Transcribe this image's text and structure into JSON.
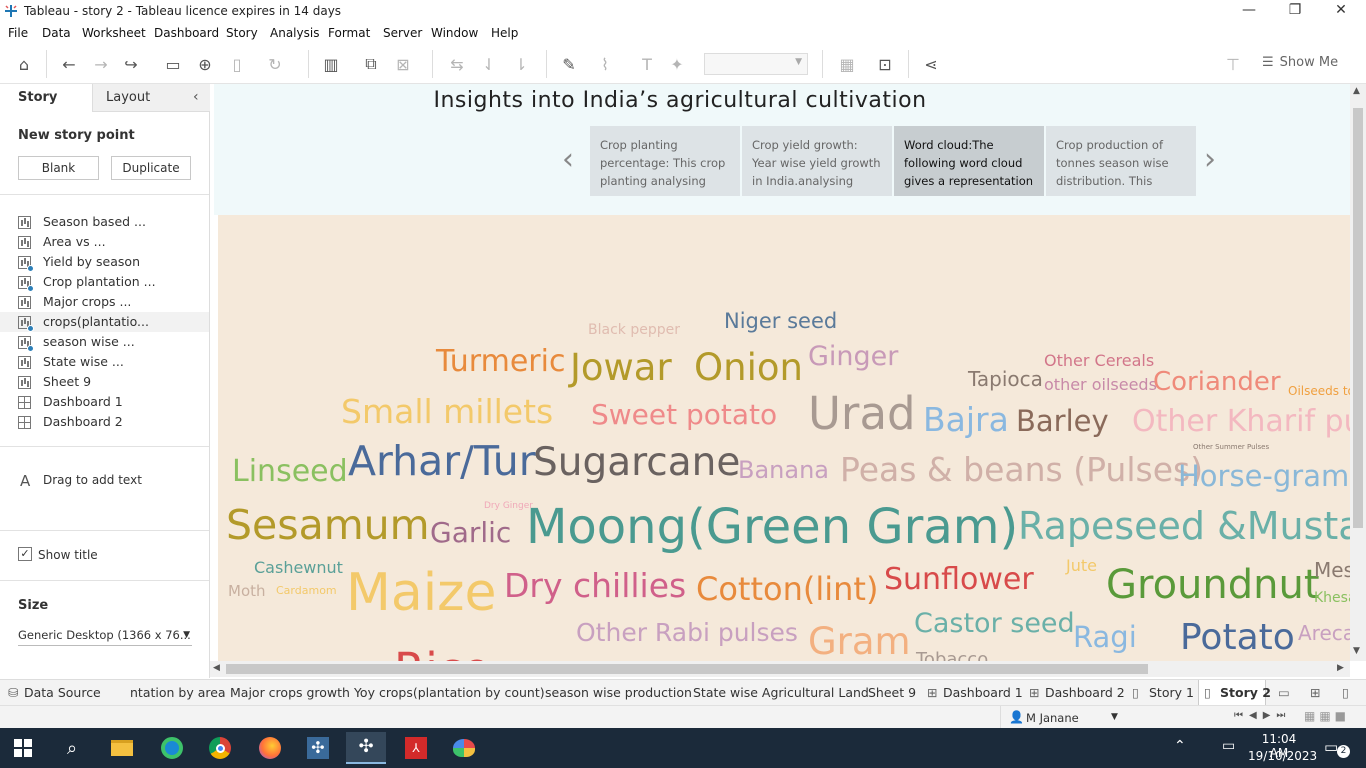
{
  "window": {
    "title": "Tableau - story 2 - Tableau licence expires in 14 days"
  },
  "menu": [
    "File",
    "Data",
    "Worksheet",
    "Dashboard",
    "Story",
    "Analysis",
    "Format",
    "Server",
    "Window",
    "Help"
  ],
  "toolbar": {
    "show_me": "Show Me"
  },
  "left_pane": {
    "tabs": [
      "Story",
      "Layout"
    ],
    "new_story_point": "New story point",
    "blank_button": "Blank",
    "duplicate_button": "Duplicate",
    "sheets": [
      {
        "label": "Season based ...",
        "type": "chart",
        "used": false
      },
      {
        "label": "Area vs ...",
        "type": "chart",
        "used": false
      },
      {
        "label": "Yield by season",
        "type": "chart",
        "used": true
      },
      {
        "label": "Crop plantation ...",
        "type": "chart",
        "used": true
      },
      {
        "label": "Major crops ...",
        "type": "chart",
        "used": false
      },
      {
        "label": "crops(plantatio...",
        "type": "chart",
        "used": true
      },
      {
        "label": "season wise ...",
        "type": "chart",
        "used": true
      },
      {
        "label": "State wise ...",
        "type": "chart",
        "used": false
      },
      {
        "label": "Sheet 9",
        "type": "chart",
        "used": false
      },
      {
        "label": "Dashboard 1",
        "type": "dash",
        "used": false
      },
      {
        "label": "Dashboard 2",
        "type": "dash",
        "used": false
      }
    ],
    "drag_text": "Drag to add text",
    "show_title": "Show title",
    "size_label": "Size",
    "size_value": "Generic Desktop (1366 x 76..."
  },
  "story": {
    "title": "Insights into India’s agricultural cultivation",
    "points": [
      "Crop planting percentage: This crop planting analysing",
      "Crop yield growth: Year wise yield growth in India.analysing",
      "Word cloud:The following word cloud gives a representation",
      "Crop production of tonnes season wise distribution. This"
    ]
  },
  "word_cloud": [
    {
      "t": "Black pepper",
      "c": "#e0bcb0"
    },
    {
      "t": "Niger seed",
      "c": "#5a7a9a"
    },
    {
      "t": "Turmeric",
      "c": "#e88a3c"
    },
    {
      "t": "Jowar",
      "c": "#b39a2a"
    },
    {
      "t": "Onion",
      "c": "#b39a2a"
    },
    {
      "t": "Ginger",
      "c": "#c89ab8"
    },
    {
      "t": "Other Cereals",
      "c": "#d2768a"
    },
    {
      "t": "Tapioca",
      "c": "#8a7a70"
    },
    {
      "t": "other oilseeds",
      "c": "#c88aa8"
    },
    {
      "t": "Coriander",
      "c": "#ef8a7a"
    },
    {
      "t": "Oilseeds total",
      "c": "#f0a040"
    },
    {
      "t": "Small millets",
      "c": "#f3c96a"
    },
    {
      "t": "Sweet potato",
      "c": "#ef8a8a"
    },
    {
      "t": "Urad",
      "c": "#a89a92"
    },
    {
      "t": "Bajra",
      "c": "#8ab8e0"
    },
    {
      "t": "Barley",
      "c": "#8a6a5a"
    },
    {
      "t": "Other Kharif pulses",
      "c": "#f3b8c0"
    },
    {
      "t": "Other Summer Pulses",
      "c": "#8a7a70"
    },
    {
      "t": "Linseed",
      "c": "#8ac060"
    },
    {
      "t": "Arhar/Tur",
      "c": "#4a6a9a"
    },
    {
      "t": "Sugarcane",
      "c": "#6a6260"
    },
    {
      "t": "Banana",
      "c": "#c8a0c0"
    },
    {
      "t": "Peas & beans (Pulses)",
      "c": "#d0b0a8"
    },
    {
      "t": "Horse-gram",
      "c": "#8ab8d8"
    },
    {
      "t": "Dry Ginger",
      "c": "#f0a8b8"
    },
    {
      "t": "Sesamum",
      "c": "#b39a2a"
    },
    {
      "t": "Garlic",
      "c": "#a06a8a"
    },
    {
      "t": "Moong(Green Gram)",
      "c": "#4a9a90"
    },
    {
      "t": "Rapeseed &Mustard",
      "c": "#6ab0a8"
    },
    {
      "t": "Cashewnut",
      "c": "#5aa098"
    },
    {
      "t": "Jute",
      "c": "#f3c96a"
    },
    {
      "t": "Moth",
      "c": "#c8b0a0"
    },
    {
      "t": "Cardamom",
      "c": "#f3c96a"
    },
    {
      "t": "Maize",
      "c": "#f3c96a"
    },
    {
      "t": "Dry chillies",
      "c": "#d0608a"
    },
    {
      "t": "Cotton(lint)",
      "c": "#e88a3c"
    },
    {
      "t": "Sunflower",
      "c": "#d84a4a"
    },
    {
      "t": "Groundnut",
      "c": "#5a9a3a"
    },
    {
      "t": "Mesta",
      "c": "#8a7a70"
    },
    {
      "t": "Khesari",
      "c": "#8ac060"
    },
    {
      "t": "Other Rabi pulses",
      "c": "#c8a0c0"
    },
    {
      "t": "Gram",
      "c": "#f3b080"
    },
    {
      "t": "Castor seed",
      "c": "#6ab0a8"
    },
    {
      "t": "Ragi",
      "c": "#8ab8e0"
    },
    {
      "t": "Potato",
      "c": "#4a6a9a"
    },
    {
      "t": "Arecanut",
      "c": "#c8a0c0"
    },
    {
      "t": "Tobacco",
      "c": "#a89a92"
    },
    {
      "t": "Rice",
      "c": "#d84a4a"
    }
  ],
  "sheet_tabs": [
    "Data Source",
    "ntation by area",
    "Major crops growth Yoy",
    "crops(plantation by count)",
    "season wise production",
    "State wise Agricultural Land",
    "Sheet 9",
    "Dashboard 1",
    "Dashboard 2",
    "Story 1",
    "Story 2"
  ],
  "status": {
    "user": "M Janane"
  },
  "taskbar": {
    "time": "11:04 AM",
    "date": "19/10/2023",
    "notifications": "2"
  }
}
